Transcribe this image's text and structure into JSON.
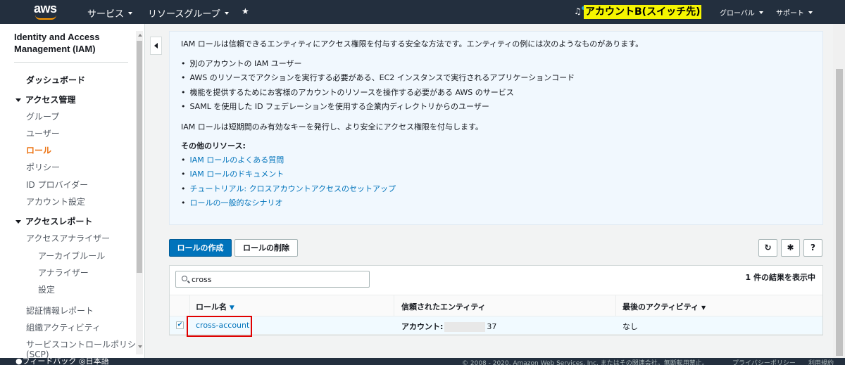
{
  "topnav": {
    "logo": "aws",
    "services": "サービス",
    "resource_groups": "リソースグループ",
    "pin_icon": "pin-icon",
    "bell_icon": "bell-icon",
    "account": "アカウントB(スイッチ先)",
    "region": "グローバル",
    "support": "サポート"
  },
  "sidebar": {
    "title": "Identity and Access Management (IAM)",
    "items": [
      {
        "label": "ダッシュボード",
        "kind": "bold"
      },
      {
        "label": "アクセス管理",
        "kind": "section"
      },
      {
        "label": "グループ",
        "kind": "sub"
      },
      {
        "label": "ユーザー",
        "kind": "sub"
      },
      {
        "label": "ロール",
        "kind": "active"
      },
      {
        "label": "ポリシー",
        "kind": "sub"
      },
      {
        "label": "ID プロバイダー",
        "kind": "sub"
      },
      {
        "label": "アカウント設定",
        "kind": "sub"
      },
      {
        "label": "アクセスレポート",
        "kind": "section"
      },
      {
        "label": "アクセスアナライザー",
        "kind": "sub"
      },
      {
        "label": "アーカイブルール",
        "kind": "sub2"
      },
      {
        "label": "アナライザー",
        "kind": "sub2"
      },
      {
        "label": "設定",
        "kind": "sub2"
      },
      {
        "label": "認証情報レポート",
        "kind": "sub"
      },
      {
        "label": "組織アクティビティ",
        "kind": "sub"
      },
      {
        "label": "サービスコントロールポリシ",
        "kind": "sub"
      },
      {
        "label": "(SCP)",
        "kind": "sub"
      }
    ]
  },
  "info": {
    "intro": "IAM ロールは信頼できるエンティティにアクセス権限を付与する安全な方法です。エンティティの例には次のようなものがあります。",
    "bullets": [
      "別のアカウントの IAM ユーザー",
      "AWS のリソースでアクションを実行する必要がある、EC2 インスタンスで実行されるアプリケーションコード",
      "機能を提供するためにお客様のアカウントのリソースを操作する必要がある AWS のサービス",
      "SAML を使用した ID フェデレーションを使用する企業内ディレクトリからのユーザー"
    ],
    "note": "IAM ロールは短期間のみ有効なキーを発行し、より安全にアクセス権限を付与します。",
    "resources_heading": "その他のリソース:",
    "links": [
      "IAM ロールのよくある質問",
      "IAM ロールのドキュメント",
      "チュートリアル: クロスアカウントアクセスのセットアップ",
      "ロールの一般的なシナリオ"
    ]
  },
  "actions": {
    "create_role": "ロールの作成",
    "delete_role": "ロールの削除",
    "refresh_icon": "refresh-icon",
    "settings_icon": "gear-icon",
    "help_icon": "help-icon"
  },
  "table": {
    "search_value": "cross",
    "result_count": "1 件の結果を表示中",
    "columns": [
      "ロール名",
      "信頼されたエンティティ",
      "最後のアクティビティ"
    ],
    "rows": [
      {
        "name": "cross-account",
        "entity_prefix": "アカウント:",
        "entity_suffix": "37",
        "last_activity": "なし",
        "selected": true
      }
    ]
  },
  "footer": {
    "feedback": "フィードバック",
    "language": "日本語",
    "copyright": "© 2008 - 2020, Amazon Web Services, Inc. またはその関連会社。無断転用禁止。",
    "privacy": "プライバシーポリシー",
    "terms": "利用規約"
  },
  "colors": {
    "nav_bg": "#232f3e",
    "primary": "#0073bb",
    "active": "#ec7211",
    "highlight": "#f5f500",
    "annotation_red": "#e00000"
  }
}
